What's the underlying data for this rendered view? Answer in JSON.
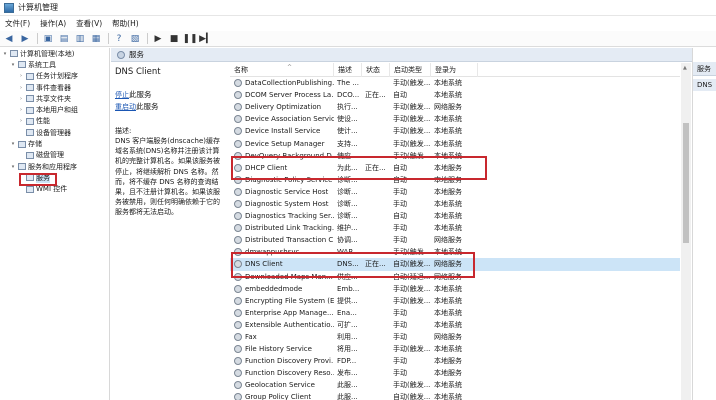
{
  "window": {
    "title": "计算机管理"
  },
  "menu": [
    "文件(F)",
    "操作(A)",
    "查看(V)",
    "帮助(H)"
  ],
  "toolbar": {
    "icons": [
      "back-icon",
      "forward-icon",
      "up-folder-icon",
      "show-hide-tree-icon",
      "export-icon",
      "properties-icon",
      "help-icon",
      "view-icon",
      "play-icon",
      "stop-icon",
      "pause-icon",
      "restart-icon"
    ]
  },
  "tree": [
    {
      "label": "计算机管理(本地)",
      "level": 0,
      "exp": "▾"
    },
    {
      "label": "系统工具",
      "level": 1,
      "exp": "▾"
    },
    {
      "label": "任务计划程序",
      "level": 2,
      "exp": "›"
    },
    {
      "label": "事件查看器",
      "level": 2,
      "exp": "›"
    },
    {
      "label": "共享文件夹",
      "level": 2,
      "exp": "›"
    },
    {
      "label": "本地用户和组",
      "level": 2,
      "exp": "›"
    },
    {
      "label": "性能",
      "level": 2,
      "exp": "›"
    },
    {
      "label": "设备管理器",
      "level": 2,
      "exp": ""
    },
    {
      "label": "存储",
      "level": 1,
      "exp": "▾"
    },
    {
      "label": "磁盘管理",
      "level": 2,
      "exp": ""
    },
    {
      "label": "服务和应用程序",
      "level": 1,
      "exp": "▾"
    },
    {
      "label": "服务",
      "level": 2,
      "exp": "",
      "selected": true
    },
    {
      "label": "WMI 控件",
      "level": 2,
      "exp": ""
    }
  ],
  "panel": {
    "header": "服务"
  },
  "details": {
    "service_name": "DNS Client",
    "stop_link": "停止",
    "stop_suffix": "此服务",
    "restart_link": "重启动",
    "restart_suffix": "此服务",
    "desc_label": "描述:",
    "desc_text": "DNS 客户端服务(dnscache)缓存域名系统(DNS)名称并注册该计算机的完整计算机名。如果该服务被停止，将继续解析 DNS 名称。然而，将不缓存 DNS 名称的查询结果，且不注册计算机名。如果该服务被禁用，则任何明确依赖于它的服务都将无法启动。"
  },
  "columns": [
    "名称",
    "描述",
    "状态",
    "启动类型",
    "登录为"
  ],
  "services": [
    {
      "name": "DataCollectionPublishing...",
      "desc": "The ...",
      "status": "",
      "start": "手动(触发...",
      "logon": "本地系统"
    },
    {
      "name": "DCOM Server Process La...",
      "desc": "DCO...",
      "status": "正在...",
      "start": "自动",
      "logon": "本地系统"
    },
    {
      "name": "Delivery Optimization",
      "desc": "执行...",
      "status": "",
      "start": "手动(触发...",
      "logon": "网络服务"
    },
    {
      "name": "Device Association Service",
      "desc": "使设...",
      "status": "",
      "start": "手动(触发...",
      "logon": "本地系统"
    },
    {
      "name": "Device Install Service",
      "desc": "使计...",
      "status": "",
      "start": "手动(触发...",
      "logon": "本地系统"
    },
    {
      "name": "Device Setup Manager",
      "desc": "支持...",
      "status": "",
      "start": "手动(触发...",
      "logon": "本地系统"
    },
    {
      "name": "DevQuery Background D...",
      "desc": "使应...",
      "status": "",
      "start": "手动(触发...",
      "logon": "本地系统"
    },
    {
      "name": "DHCP Client",
      "desc": "为此...",
      "status": "正在...",
      "start": "自动",
      "logon": "本地服务"
    },
    {
      "name": "Diagnostic Policy Service",
      "desc": "诊断...",
      "status": "",
      "start": "自动",
      "logon": "本地服务"
    },
    {
      "name": "Diagnostic Service Host",
      "desc": "诊断...",
      "status": "",
      "start": "手动",
      "logon": "本地服务"
    },
    {
      "name": "Diagnostic System Host",
      "desc": "诊断...",
      "status": "",
      "start": "手动",
      "logon": "本地系统"
    },
    {
      "name": "Diagnostics Tracking Ser...",
      "desc": "诊断...",
      "status": "",
      "start": "自动",
      "logon": "本地系统"
    },
    {
      "name": "Distributed Link Tracking...",
      "desc": "维护...",
      "status": "",
      "start": "手动",
      "logon": "本地系统"
    },
    {
      "name": "Distributed Transaction C...",
      "desc": "协调...",
      "status": "",
      "start": "手动",
      "logon": "网络服务"
    },
    {
      "name": "dmwappushsvc",
      "desc": "WAP...",
      "status": "",
      "start": "手动(触发...",
      "logon": "本地系统"
    },
    {
      "name": "DNS Client",
      "desc": "DNS...",
      "status": "正在...",
      "start": "自动(触发...",
      "logon": "网络服务",
      "selected": true
    },
    {
      "name": "Downloaded Maps Man...",
      "desc": "供应...",
      "status": "",
      "start": "自动(延迟...",
      "logon": "网络服务"
    },
    {
      "name": "embeddedmode",
      "desc": "Emb...",
      "status": "",
      "start": "手动(触发...",
      "logon": "本地系统"
    },
    {
      "name": "Encrypting File System (E...",
      "desc": "提供...",
      "status": "",
      "start": "手动(触发...",
      "logon": "本地系统"
    },
    {
      "name": "Enterprise App Manage...",
      "desc": "Ena...",
      "status": "",
      "start": "手动",
      "logon": "本地系统"
    },
    {
      "name": "Extensible Authenticatio...",
      "desc": "可扩...",
      "status": "",
      "start": "手动",
      "logon": "本地系统"
    },
    {
      "name": "Fax",
      "desc": "利用...",
      "status": "",
      "start": "手动",
      "logon": "网络服务"
    },
    {
      "name": "File History Service",
      "desc": "将用...",
      "status": "",
      "start": "手动(触发...",
      "logon": "本地系统"
    },
    {
      "name": "Function Discovery Provi...",
      "desc": "FDP...",
      "status": "",
      "start": "手动",
      "logon": "本地服务"
    },
    {
      "name": "Function Discovery Reso...",
      "desc": "发布...",
      "status": "",
      "start": "手动",
      "logon": "本地服务"
    },
    {
      "name": "Geolocation Service",
      "desc": "此服...",
      "status": "",
      "start": "手动(触发...",
      "logon": "本地系统"
    },
    {
      "name": "Group Policy Client",
      "desc": "此服...",
      "status": "",
      "start": "自动(触发...",
      "logon": "本地系统"
    }
  ],
  "actions": {
    "header": "服务",
    "item": "DNS"
  },
  "colors": {
    "highlight_box": "#c8282e",
    "selection": "#cce4f7",
    "link": "#1a56b3",
    "panel_header": "#e4ebf4"
  }
}
